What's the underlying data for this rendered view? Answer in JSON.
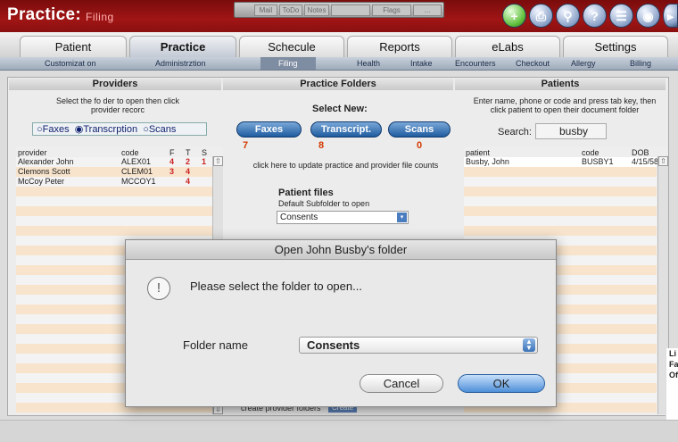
{
  "app": {
    "title": "Practice:",
    "subtitle": "Filing"
  },
  "messages": {
    "mail": "Mail",
    "todo": "ToDo",
    "notes": "Notes",
    "flags": "Flags",
    "more": "..."
  },
  "toolbar_icons": [
    "add-icon",
    "print-icon",
    "search-icon",
    "help-icon",
    "menu-icon",
    "lock-icon",
    "exit-icon"
  ],
  "tabs": [
    "Patient",
    "Practice",
    "Schecule",
    "Reports",
    "eLabs",
    "Settings"
  ],
  "subtabs": [
    "Customizat on",
    "Administrztion",
    "Filing",
    "Health",
    "Intake",
    "Encounters",
    "Checkout",
    "Allergy",
    "Billing"
  ],
  "providers": {
    "header": "Providers",
    "instructions": "Select the fo der to open then click provider recorc",
    "radios": {
      "faxes": "Faxes",
      "transcription": "Transcrption",
      "scans": "Scans"
    },
    "columns": {
      "provider": "provider",
      "code": "code",
      "f": "F",
      "t": "T",
      "s": "S"
    },
    "rows": [
      {
        "provider": "Alexander John",
        "code": "ALEX01",
        "f": "4",
        "t": "2",
        "s": "1"
      },
      {
        "provider": "Clemons Scott",
        "code": "CLEM01",
        "f": "3",
        "t": "4",
        "s": ""
      },
      {
        "provider": "McCoy Peter",
        "code": "MCCOY1",
        "f": "",
        "t": "4",
        "s": ""
      }
    ],
    "create_label": "create provider folders",
    "create_button": "Create"
  },
  "practice": {
    "header": "Practice Folders",
    "select_new": "Select New:",
    "buttons": {
      "faxes": "Faxes",
      "transcript": "Transcript.",
      "scans": "Scans"
    },
    "counts": {
      "faxes": "7",
      "transcript": "8",
      "scans": "0"
    },
    "update_note": "click here to update practice and provider file counts",
    "patient_files": "Patient files",
    "default_sub": "Default Subfolder to open",
    "default_value": "Consents"
  },
  "patients": {
    "header": "Patients",
    "instructions": "Enter name, phone or code and press tab key, then click patient to open their document folder",
    "search_label": "Search:",
    "search_value": "busby",
    "columns": {
      "patient": "patient",
      "code": "code",
      "dob": "DOB"
    },
    "rows": [
      {
        "patient": "Busby, John",
        "code": "BUSBY1",
        "dob": "4/15/58"
      }
    ]
  },
  "dialog": {
    "title": "Open John Busby's folder",
    "message": "Please select the folder to open...",
    "folder_label": "Folder name",
    "folder_value": "Consents",
    "cancel": "Cancel",
    "ok": "OK"
  },
  "side_panel": [
    "Li",
    "Fa",
    "Of"
  ]
}
